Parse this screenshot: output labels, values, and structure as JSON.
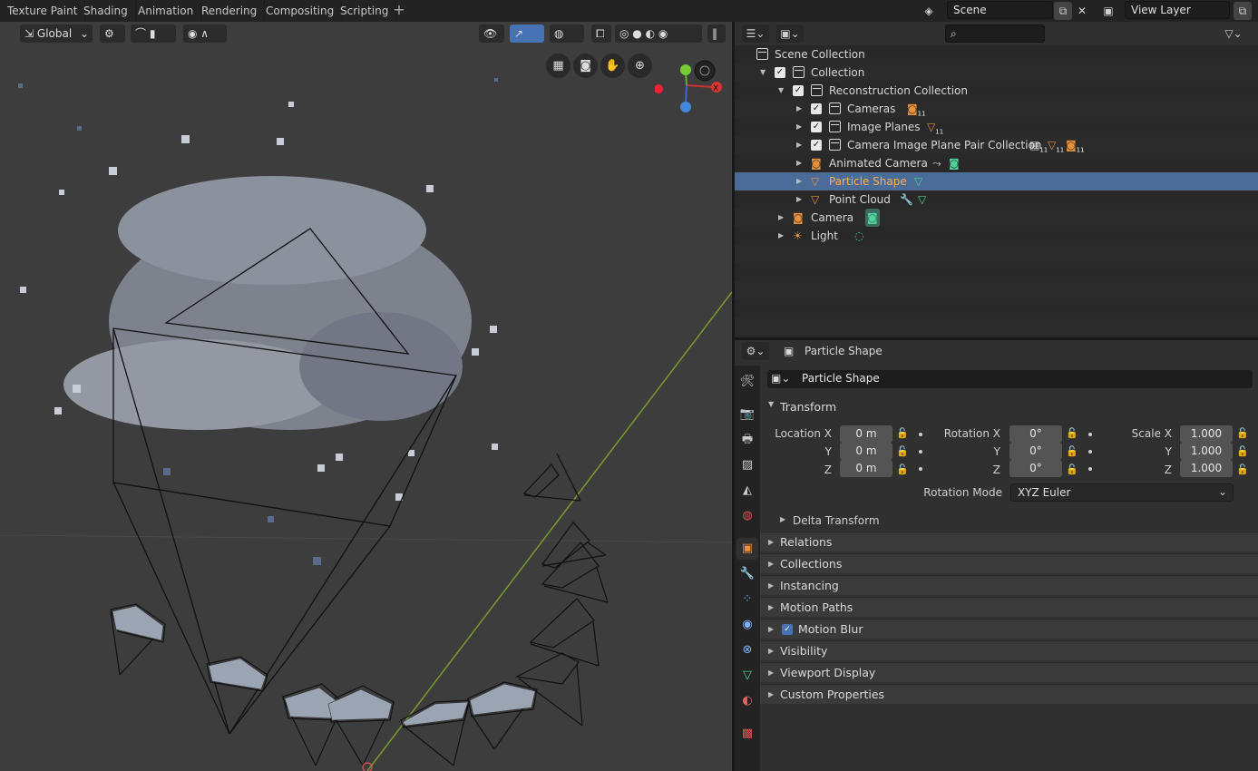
{
  "workspace_tabs": [
    "Texture Paint",
    "Shading",
    "Animation",
    "Rendering",
    "Compositing",
    "Scripting"
  ],
  "topbar": {
    "scene": "Scene",
    "view_layer": "View Layer"
  },
  "viewport": {
    "orientation": "Global"
  },
  "outliner": {
    "search_placeholder": "",
    "rows": [
      {
        "label": "Scene Collection"
      },
      {
        "label": "Collection"
      },
      {
        "label": "Reconstruction Collection"
      },
      {
        "label": "Cameras",
        "badge": "11"
      },
      {
        "label": "Image Planes",
        "badge": "11"
      },
      {
        "label": "Camera Image Plane Pair Collection",
        "badge1": "11",
        "badge2": "11",
        "badge3": "11"
      },
      {
        "label": "Animated Camera"
      },
      {
        "label": "Particle Shape"
      },
      {
        "label": "Point Cloud"
      },
      {
        "label": "Camera"
      },
      {
        "label": "Light"
      }
    ]
  },
  "properties": {
    "header_object": "Particle Shape",
    "object_name": "Particle Shape",
    "transform_title": "Transform",
    "location_x_label": "Location X",
    "rotation_x_label": "Rotation X",
    "scale_x_label": "Scale X",
    "y_label": "Y",
    "z_label": "Z",
    "location": [
      "0 m",
      "0 m",
      "0 m"
    ],
    "rotation": [
      "0°",
      "0°",
      "0°"
    ],
    "scale": [
      "1.000",
      "1.000",
      "1.000"
    ],
    "rotation_mode_label": "Rotation Mode",
    "rotation_mode": "XYZ Euler",
    "delta_transform": "Delta Transform",
    "panels": [
      "Relations",
      "Collections",
      "Instancing",
      "Motion Paths",
      "Motion Blur",
      "Visibility",
      "Viewport Display",
      "Custom Properties"
    ]
  },
  "colors": {
    "selection": "#4b6b99",
    "object_orange": "#e8913a",
    "data_green": "#4fd39a"
  }
}
